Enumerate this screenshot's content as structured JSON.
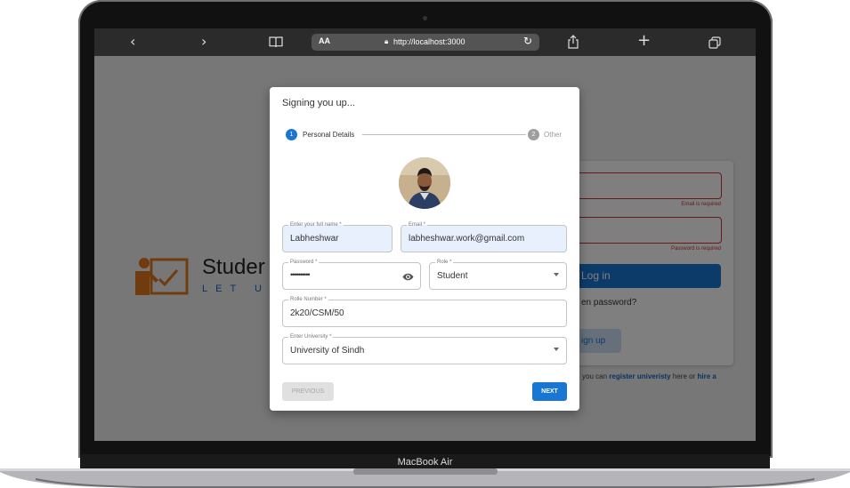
{
  "device": {
    "label": "MacBook Air"
  },
  "browser": {
    "aa_label": "AA",
    "url": "http://localhost:3000"
  },
  "background_page": {
    "logo": {
      "title": "Studer",
      "tagline": "LET US"
    },
    "login": {
      "email_error": "Email is required",
      "password_error": "Password is required",
      "login_button": "Log in",
      "forgot_text": "en password?",
      "signup_button": "ign up"
    },
    "footer": {
      "prefix": "you can",
      "link1": "register univeristy",
      "middle": "here or",
      "link2": "hire a"
    }
  },
  "modal": {
    "title": "Signing you up...",
    "steps": [
      {
        "number": "1",
        "label": "Personal Details",
        "active": true
      },
      {
        "number": "2",
        "label": "Other",
        "active": false
      }
    ],
    "fields": {
      "full_name": {
        "label": "Enter your full name *",
        "value": "Labheshwar"
      },
      "email": {
        "label": "Email *",
        "value": "labheshwar.work@gmail.com"
      },
      "password": {
        "label": "Password *",
        "value": "••••••••••"
      },
      "role": {
        "label": "Role *",
        "value": "Student"
      },
      "roll_number": {
        "label": "Rolle Number *",
        "value": "2k20/CSM/50"
      },
      "university": {
        "label": "Enter University *",
        "value": "University of Sindh"
      }
    },
    "buttons": {
      "previous": "PREVIOUS",
      "next": "NEXT"
    }
  },
  "colors": {
    "primary": "#1976d2",
    "error": "#d32f2f",
    "logo_orange": "#e0781e",
    "autofill": "#e8f0fe"
  },
  "icons": [
    "back-icon",
    "forward-icon",
    "book-icon",
    "lock-icon",
    "reload-icon",
    "share-icon",
    "plus-icon",
    "tabs-icon",
    "eye-icon",
    "dropdown-icon"
  ]
}
